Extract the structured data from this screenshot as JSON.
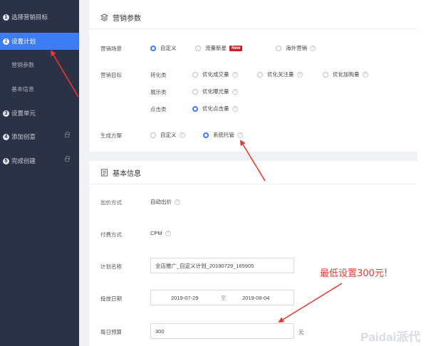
{
  "sidebar": {
    "steps": [
      {
        "num": "1",
        "label": "选择营销目标"
      },
      {
        "num": "2",
        "label": "设置计划"
      },
      {
        "num": "3",
        "label": "设置单元"
      },
      {
        "num": "4",
        "label": "添加创意"
      },
      {
        "num": "5",
        "label": "完成创建"
      }
    ],
    "substeps": [
      {
        "label": "营销参数"
      },
      {
        "label": "基本信息"
      }
    ]
  },
  "marketing": {
    "title": "营销参数",
    "scene_label": "营销场景",
    "scene_options": [
      "自定义",
      "流量新星",
      "海外营销"
    ],
    "new_badge": "New",
    "goal_label": "营销目标",
    "groups": [
      {
        "name": "转化类",
        "options": [
          "优化成交量",
          "优化关注量",
          "优化加购量"
        ]
      },
      {
        "name": "展示类",
        "options": [
          "优化曝光量"
        ]
      },
      {
        "name": "点击类",
        "options": [
          "优化点击量"
        ]
      }
    ],
    "plan_label": "生成方案",
    "plan_options": [
      "自定义",
      "系统托管"
    ]
  },
  "basic": {
    "title": "基本信息",
    "bid_label": "出价方式",
    "bid_value": "自动出价",
    "pay_label": "付费方式",
    "pay_value": "CPM",
    "name_label": "计划名称",
    "name_value": "全店推广_自定义计划_20190729_165905",
    "date_label": "投放日期",
    "date_start": "2019-07-29",
    "date_sep": "至",
    "date_end": "2019-08-04",
    "budget_label": "每日预算",
    "budget_value": "300",
    "budget_unit": "元"
  },
  "annotation": "最低设置300元!",
  "watermark": "Paidai派代",
  "colors": {
    "accent": "#3d7cf5",
    "sidebar": "#2b3245",
    "annotation": "#e8392f"
  }
}
